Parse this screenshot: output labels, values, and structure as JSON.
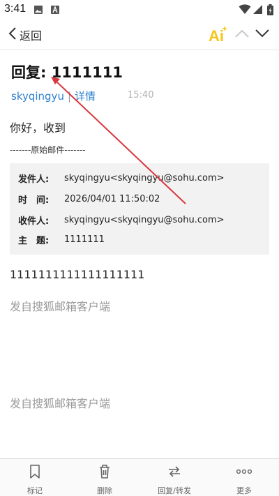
{
  "status_bar": {
    "time": "3:41",
    "icons": [
      "image-icon",
      "keyboard-a-icon",
      "wifi-icon",
      "signal-icon",
      "battery-charging-icon"
    ]
  },
  "navbar": {
    "back_label": "返回",
    "ai_label": "Ai",
    "ai_color": "#f5c518",
    "prev_icon": "chevron-up-icon",
    "next_icon": "chevron-down-icon"
  },
  "mail": {
    "subject": "回复: 1111111",
    "sender": "skyqingyu",
    "separator": "|",
    "details_link": "详情",
    "time": "15:40",
    "greeting": "你好，收到",
    "original_divider": "-------原始邮件-------",
    "original": {
      "rows": [
        {
          "label": "发件人:",
          "value": "skyqingyu<skyqingyu@sohu.com>"
        },
        {
          "label": "时　间:",
          "value": "2026/04/01 11:50:02"
        },
        {
          "label": "收件人:",
          "value": "skyqingyu<skyqingyu@sohu.com>"
        },
        {
          "label": "主　题:",
          "value": "1111111"
        }
      ]
    },
    "body_text": "1111111111111111111",
    "signature_1": "发自搜狐邮箱客户端",
    "signature_2": "发自搜狐邮箱客户端"
  },
  "toolbar": {
    "items": [
      {
        "label": "标记",
        "icon": "bookmark-icon"
      },
      {
        "label": "删除",
        "icon": "trash-icon"
      },
      {
        "label": "回复/转发",
        "icon": "reply-forward-icon"
      },
      {
        "label": "更多",
        "icon": "more-dots-icon"
      }
    ]
  },
  "colors": {
    "link": "#2f80d0",
    "annotation_arrow": "#d9363e"
  }
}
